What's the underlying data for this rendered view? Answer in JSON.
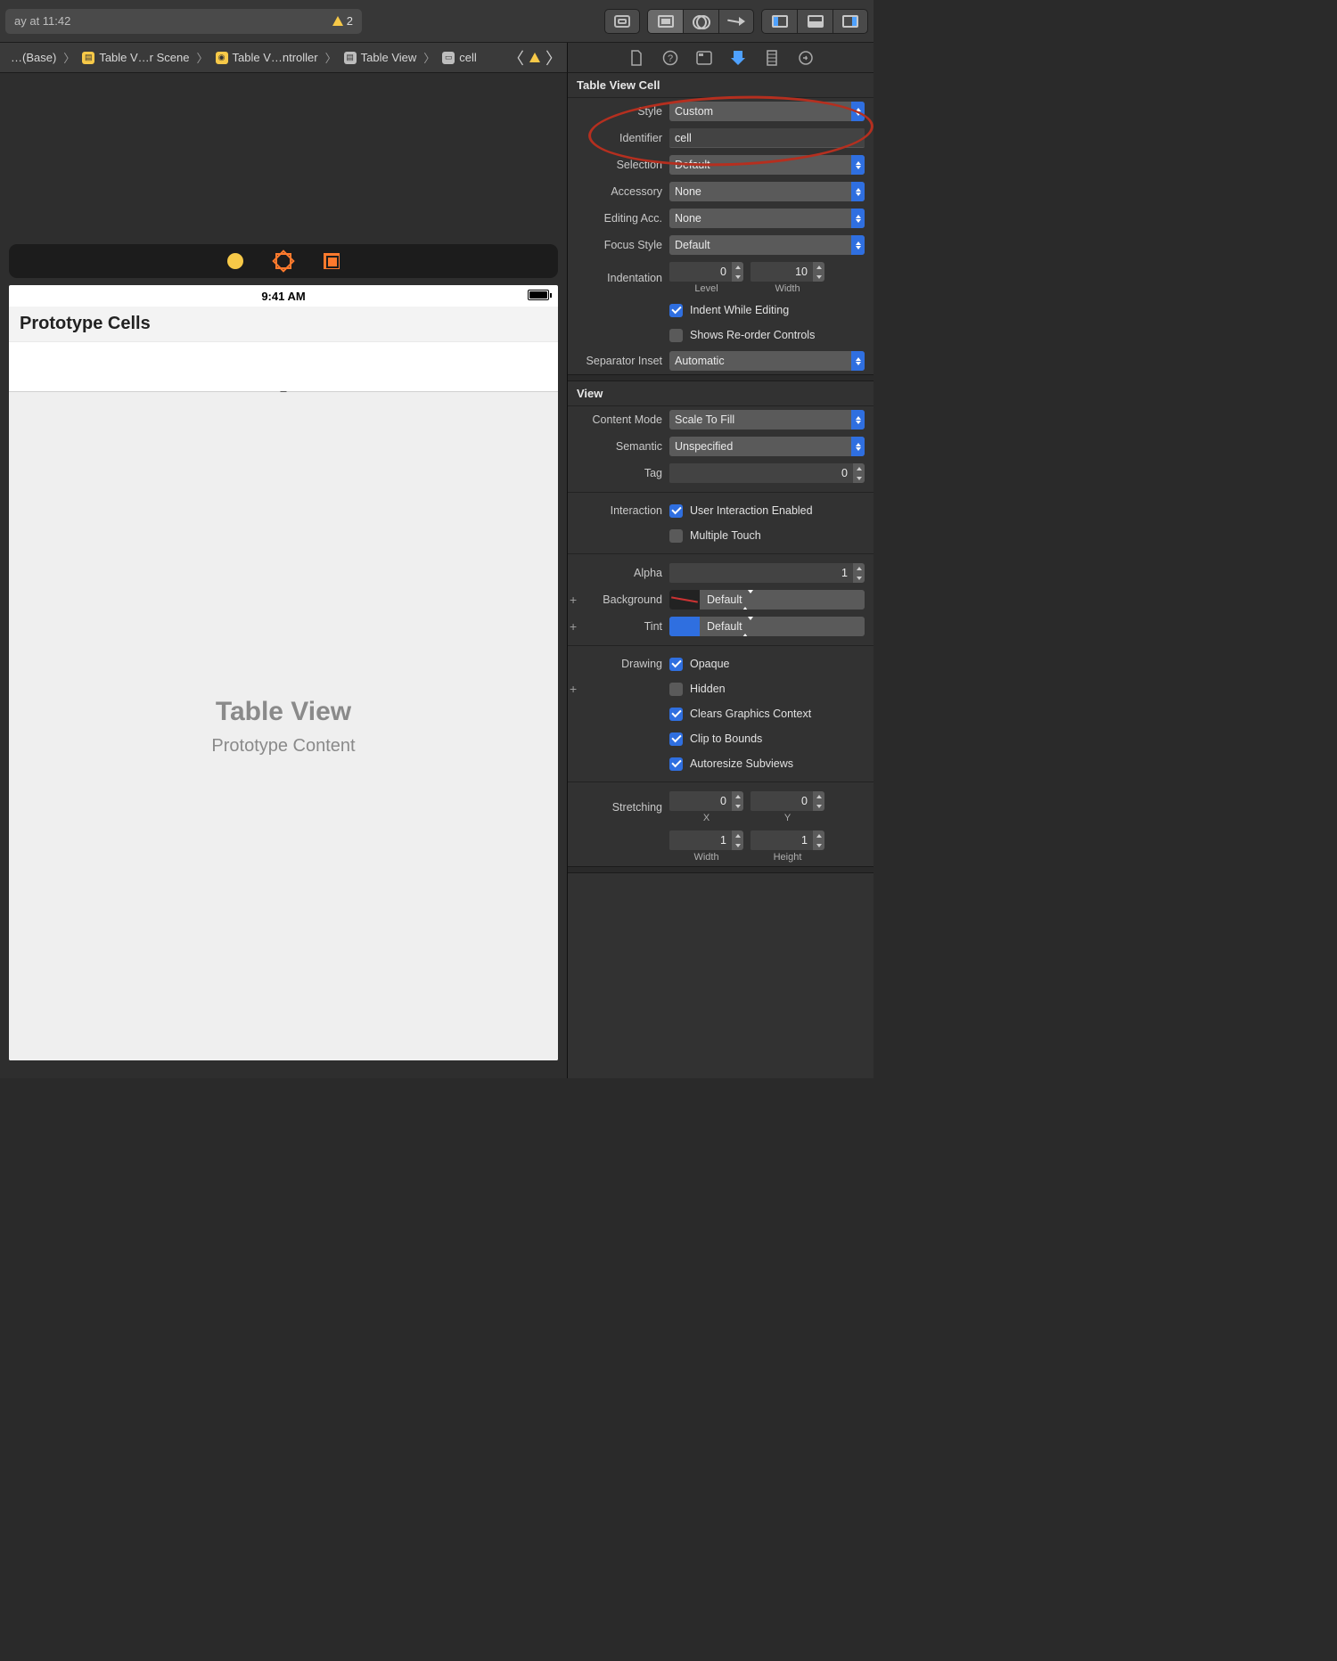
{
  "toolbar": {
    "status_left": "ay at 11:42",
    "warning_count": "2"
  },
  "breadcrumbs": {
    "items": [
      {
        "icon": "none",
        "label": "…(Base)"
      },
      {
        "icon": "yellow",
        "label": "Table V…r Scene"
      },
      {
        "icon": "yellow",
        "label": "Table V…ntroller"
      },
      {
        "icon": "gray",
        "label": "Table View"
      },
      {
        "icon": "gray",
        "label": "cell"
      }
    ]
  },
  "phone": {
    "time": "9:41 AM",
    "proto_header": "Prototype Cells",
    "placeholder_title": "Table View",
    "placeholder_subtitle": "Prototype Content"
  },
  "inspector": {
    "cell": {
      "title": "Table View Cell",
      "style": {
        "label": "Style",
        "value": "Custom"
      },
      "identifier": {
        "label": "Identifier",
        "value": "cell"
      },
      "selection": {
        "label": "Selection",
        "value": "Default"
      },
      "accessory": {
        "label": "Accessory",
        "value": "None"
      },
      "editing_acc": {
        "label": "Editing Acc.",
        "value": "None"
      },
      "focus_style": {
        "label": "Focus Style",
        "value": "Default"
      },
      "indentation": {
        "label": "Indentation",
        "level": "0",
        "level_sub": "Level",
        "width": "10",
        "width_sub": "Width"
      },
      "indent_while_editing": {
        "label": "Indent While Editing",
        "checked": true
      },
      "reorder": {
        "label": "Shows Re-order Controls",
        "checked": false
      },
      "sep_inset": {
        "label": "Separator Inset",
        "value": "Automatic"
      }
    },
    "view": {
      "title": "View",
      "content_mode": {
        "label": "Content Mode",
        "value": "Scale To Fill"
      },
      "semantic": {
        "label": "Semantic",
        "value": "Unspecified"
      },
      "tag": {
        "label": "Tag",
        "value": "0"
      },
      "interaction_label": "Interaction",
      "user_interaction": {
        "label": "User Interaction Enabled",
        "checked": true
      },
      "multiple_touch": {
        "label": "Multiple Touch",
        "checked": false
      },
      "alpha": {
        "label": "Alpha",
        "value": "1"
      },
      "background": {
        "label": "Background",
        "value": "Default"
      },
      "tint": {
        "label": "Tint",
        "value": "Default"
      },
      "drawing_label": "Drawing",
      "drawing": {
        "opaque": {
          "label": "Opaque",
          "checked": true
        },
        "hidden": {
          "label": "Hidden",
          "checked": false
        },
        "clears": {
          "label": "Clears Graphics Context",
          "checked": true
        },
        "clip": {
          "label": "Clip to Bounds",
          "checked": true
        },
        "auto": {
          "label": "Autoresize Subviews",
          "checked": true
        }
      },
      "stretching": {
        "label": "Stretching",
        "x": "0",
        "x_sub": "X",
        "y": "0",
        "y_sub": "Y",
        "w": "1",
        "w_sub": "Width",
        "h": "1",
        "h_sub": "Height"
      }
    }
  }
}
